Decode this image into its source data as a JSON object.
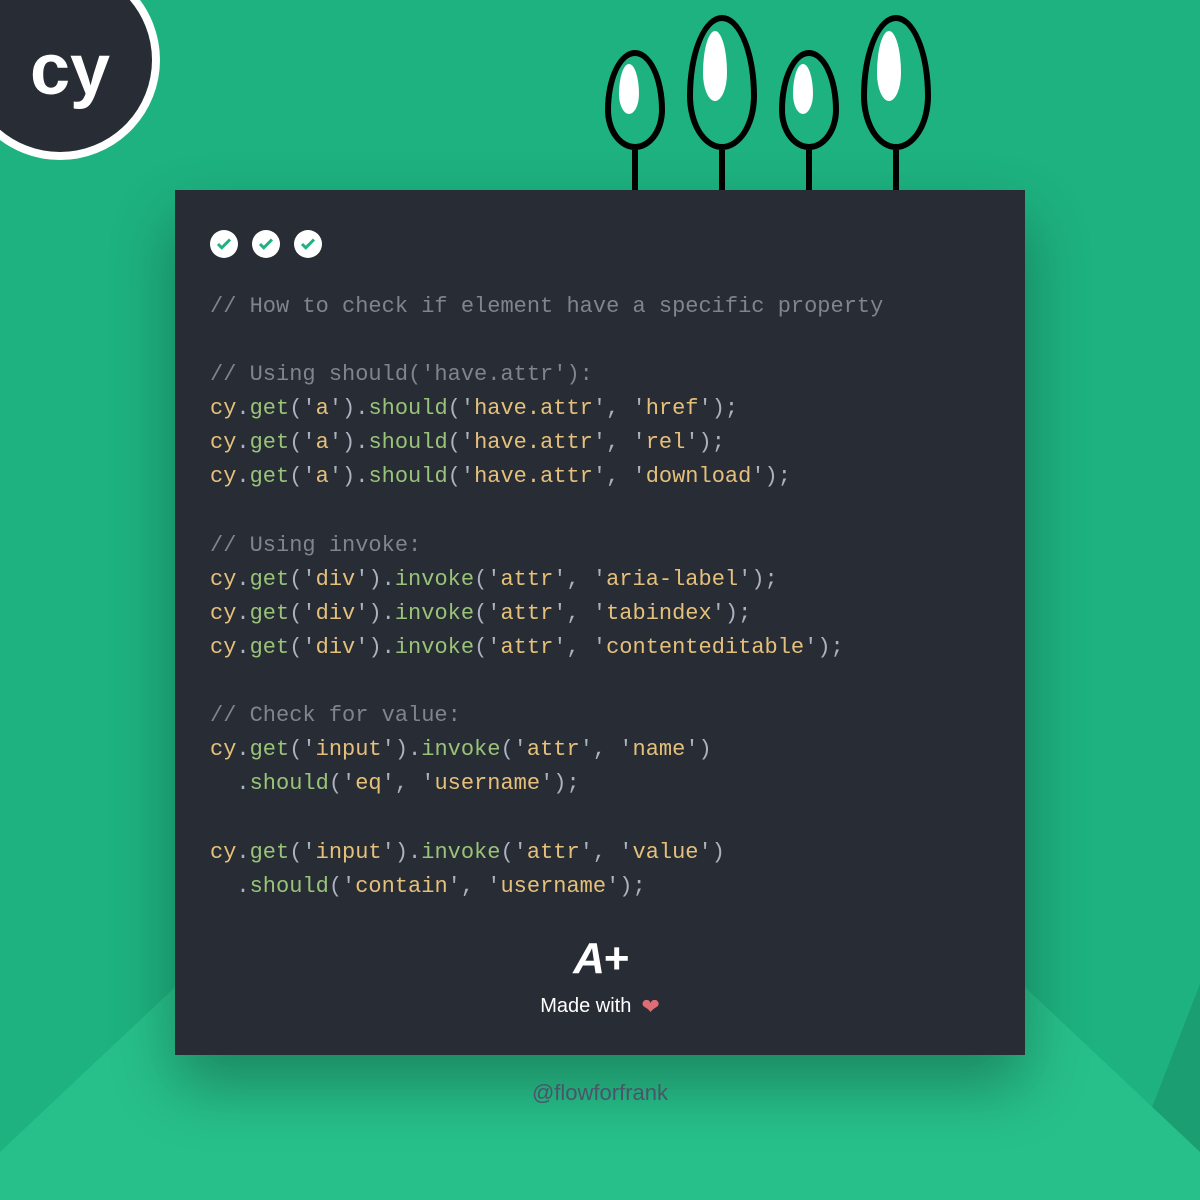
{
  "logo_text": "cy",
  "comment_title": "// How to check if element have a specific property",
  "section1_comment": "// Using should('have.attr'):",
  "section2_comment": "// Using invoke:",
  "section3_comment": "// Check for value:",
  "lines": {
    "l1": {
      "m1": "get",
      "s1": "a",
      "m2": "should",
      "s2": "have.attr",
      "s3": "href"
    },
    "l2": {
      "m1": "get",
      "s1": "a",
      "m2": "should",
      "s2": "have.attr",
      "s3": "rel"
    },
    "l3": {
      "m1": "get",
      "s1": "a",
      "m2": "should",
      "s2": "have.attr",
      "s3": "download"
    },
    "l4": {
      "m1": "get",
      "s1": "div",
      "m2": "invoke",
      "s2": "attr",
      "s3": "aria-label"
    },
    "l5": {
      "m1": "get",
      "s1": "div",
      "m2": "invoke",
      "s2": "attr",
      "s3": "tabindex"
    },
    "l6": {
      "m1": "get",
      "s1": "div",
      "m2": "invoke",
      "s2": "attr",
      "s3": "contenteditable"
    },
    "l7": {
      "m1": "get",
      "s1": "input",
      "m2": "invoke",
      "s2": "attr",
      "s3": "name"
    },
    "l7b": {
      "m3": "should",
      "s4": "eq",
      "s5": "username"
    },
    "l8": {
      "m1": "get",
      "s1": "input",
      "m2": "invoke",
      "s2": "attr",
      "s3": "value"
    },
    "l8b": {
      "m3": "should",
      "s4": "contain",
      "s5": "username"
    }
  },
  "obj_name": "cy",
  "footer_logo": "A+",
  "made_with": "Made with",
  "handle": "@flowforfrank"
}
